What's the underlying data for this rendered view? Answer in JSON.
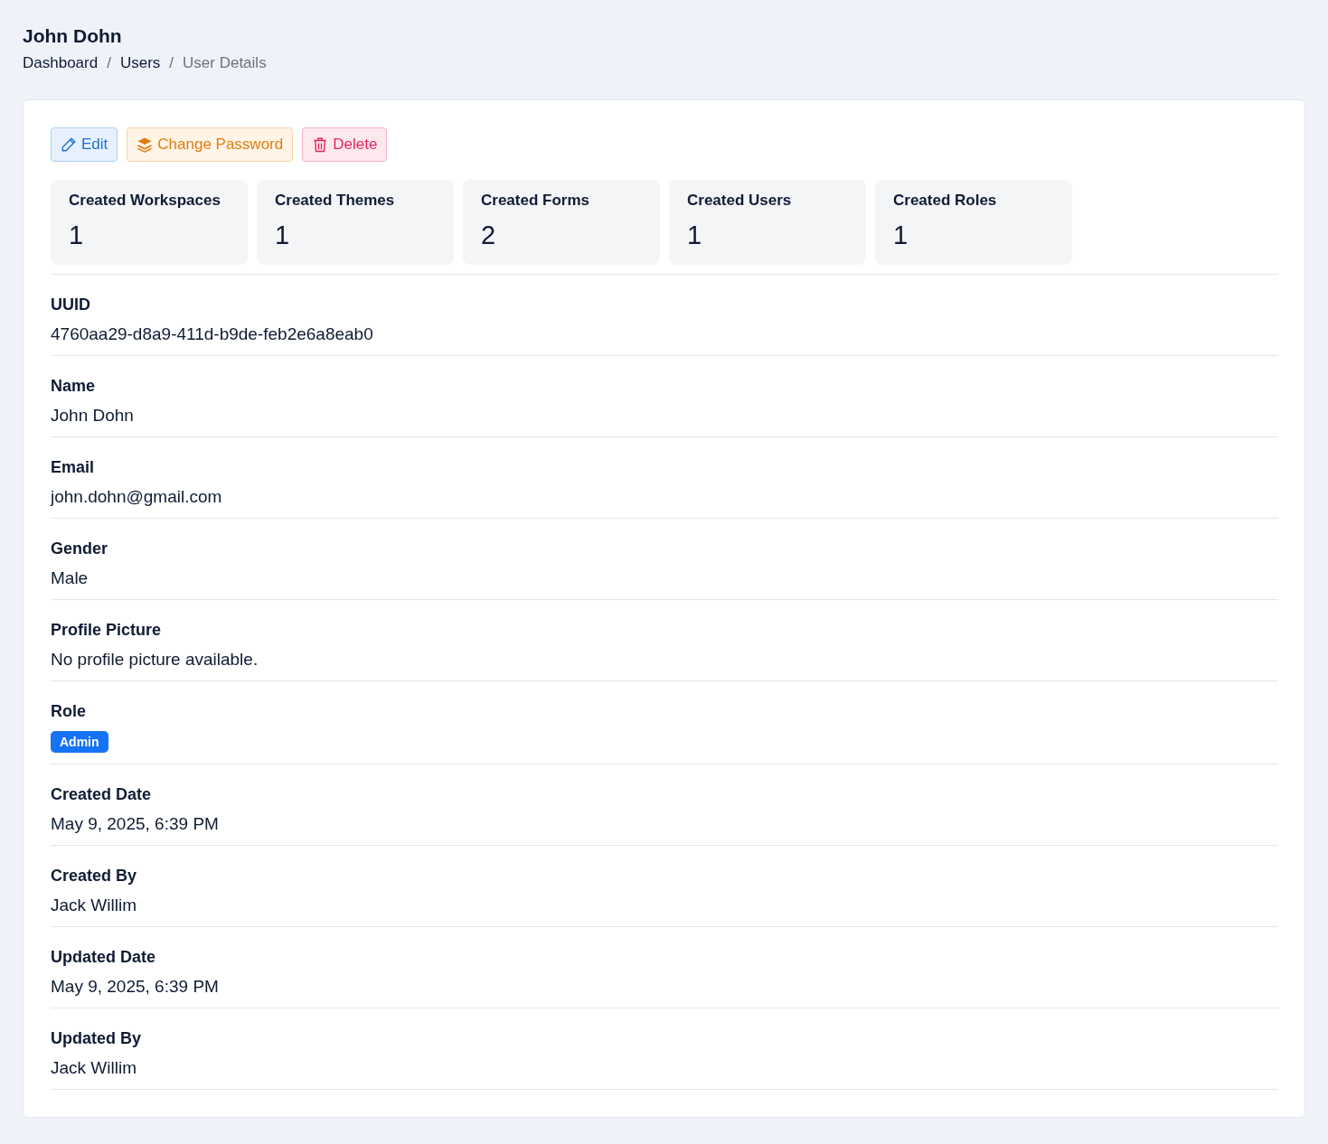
{
  "page_title": "John Dohn",
  "breadcrumb_separator": "/",
  "breadcrumb": [
    {
      "label": "Dashboard",
      "current": false
    },
    {
      "label": "Users",
      "current": false
    },
    {
      "label": "User Details",
      "current": true
    }
  ],
  "actions": [
    {
      "kind": "edit",
      "label": "Edit"
    },
    {
      "kind": "password",
      "label": "Change Password"
    },
    {
      "kind": "delete",
      "label": "Delete"
    }
  ],
  "stats": [
    {
      "label": "Created Workspaces",
      "value": "1"
    },
    {
      "label": "Created Themes",
      "value": "1"
    },
    {
      "label": "Created Forms",
      "value": "2"
    },
    {
      "label": "Created Users",
      "value": "1"
    },
    {
      "label": "Created Roles",
      "value": "1"
    }
  ],
  "fields": [
    {
      "kind": "text",
      "label": "UUID",
      "value": "4760aa29-d8a9-411d-b9de-feb2e6a8eab0"
    },
    {
      "kind": "text",
      "label": "Name",
      "value": "John Dohn"
    },
    {
      "kind": "text",
      "label": "Email",
      "value": "john.dohn@gmail.com"
    },
    {
      "kind": "text",
      "label": "Gender",
      "value": "Male"
    },
    {
      "kind": "text",
      "label": "Profile Picture",
      "value": "No profile picture available."
    },
    {
      "kind": "badge",
      "label": "Role",
      "value": "Admin"
    },
    {
      "kind": "text",
      "label": "Created Date",
      "value": "May 9, 2025, 6:39 PM"
    },
    {
      "kind": "text",
      "label": "Created By",
      "value": "Jack Willim"
    },
    {
      "kind": "text",
      "label": "Updated Date",
      "value": "May 9, 2025, 6:39 PM"
    },
    {
      "kind": "text",
      "label": "Updated By",
      "value": "Jack Willim"
    }
  ]
}
